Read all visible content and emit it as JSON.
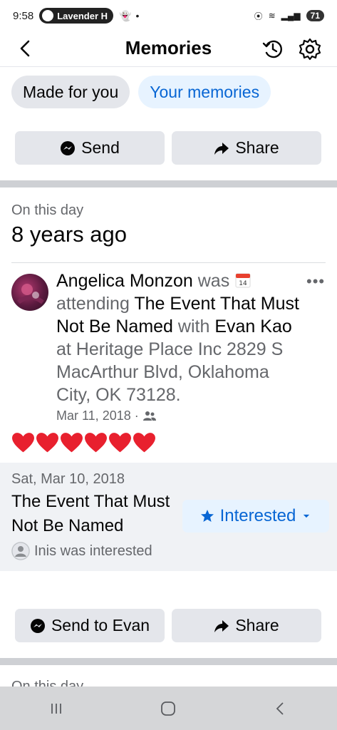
{
  "status_bar": {
    "time": "9:58",
    "notification_pill": "Lavender H",
    "battery": "71"
  },
  "header": {
    "title": "Memories"
  },
  "tabs": [
    {
      "label": "Made for you",
      "active": false
    },
    {
      "label": "Your memories",
      "active": true
    }
  ],
  "top_actions": {
    "send_label": "Send",
    "share_label": "Share"
  },
  "memory": {
    "section_label": "On this day",
    "years_ago": "8 years ago",
    "post": {
      "author": "Angelica Monzon",
      "verb": "was",
      "attending_word": "attending",
      "event_name": "The Event That Must Not Be Named",
      "with_word": "with",
      "friend": "Evan Kao",
      "location_text": "at Heritage Place Inc 2829 S MacArthur Blvd, Oklahoma City, OK 73128.",
      "date": "Mar 11, 2018 ·"
    },
    "reactions_count": 6,
    "event_card": {
      "date": "Sat, Mar 10, 2018",
      "title": "The Event That Must Not Be Named",
      "interested_label": "Interested",
      "interested_by": "Inis was interested"
    },
    "bottom_actions": {
      "send_label": "Send to Evan",
      "share_label": "Share"
    }
  },
  "next_section_partial": "On this day",
  "colors": {
    "accent_blue": "#0866d4",
    "chip_blue_bg": "#e7f3ff",
    "button_gray": "#e4e6eb",
    "heart_red": "#e8202e"
  }
}
